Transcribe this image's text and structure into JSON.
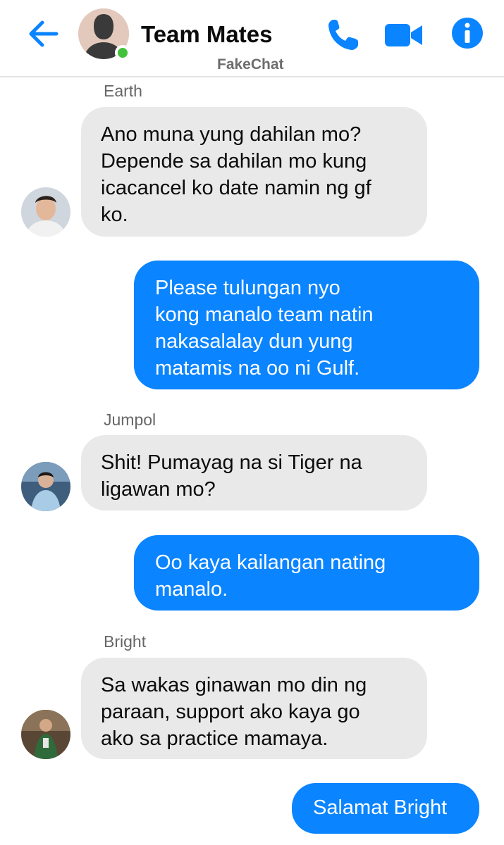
{
  "header": {
    "title": "Team Mates",
    "subtitle": "FakeChat",
    "icons": [
      "back-arrow-icon",
      "phone-icon",
      "video-camera-icon",
      "info-icon"
    ],
    "online": true
  },
  "colors": {
    "accent": "#0a84ff",
    "incoming_bubble": "#e9e9e9",
    "online": "#42c23b"
  },
  "messages": [
    {
      "sender": "Earth",
      "direction": "incoming",
      "lines": [
        "Ano muna yung dahilan mo?",
        "Depende sa dahilan mo kung",
        "icacancel ko date namin ng gf",
        "ko."
      ]
    },
    {
      "direction": "outgoing",
      "lines": [
        "Please tulungan nyo",
        "kong manalo team natin",
        "nakasalalay dun yung",
        "matamis na oo ni Gulf."
      ]
    },
    {
      "sender": "Jumpol",
      "direction": "incoming",
      "lines": [
        "Shit! Pumayag na si Tiger na",
        "ligawan mo?"
      ]
    },
    {
      "direction": "outgoing",
      "lines": [
        "Oo kaya kailangan nating",
        "manalo."
      ]
    },
    {
      "sender": "Bright",
      "direction": "incoming",
      "lines": [
        "Sa wakas ginawan mo din ng",
        "paraan, support ako kaya go",
        "ako sa practice mamaya."
      ]
    },
    {
      "direction": "outgoing",
      "lines": [
        "Salamat Bright"
      ]
    }
  ]
}
